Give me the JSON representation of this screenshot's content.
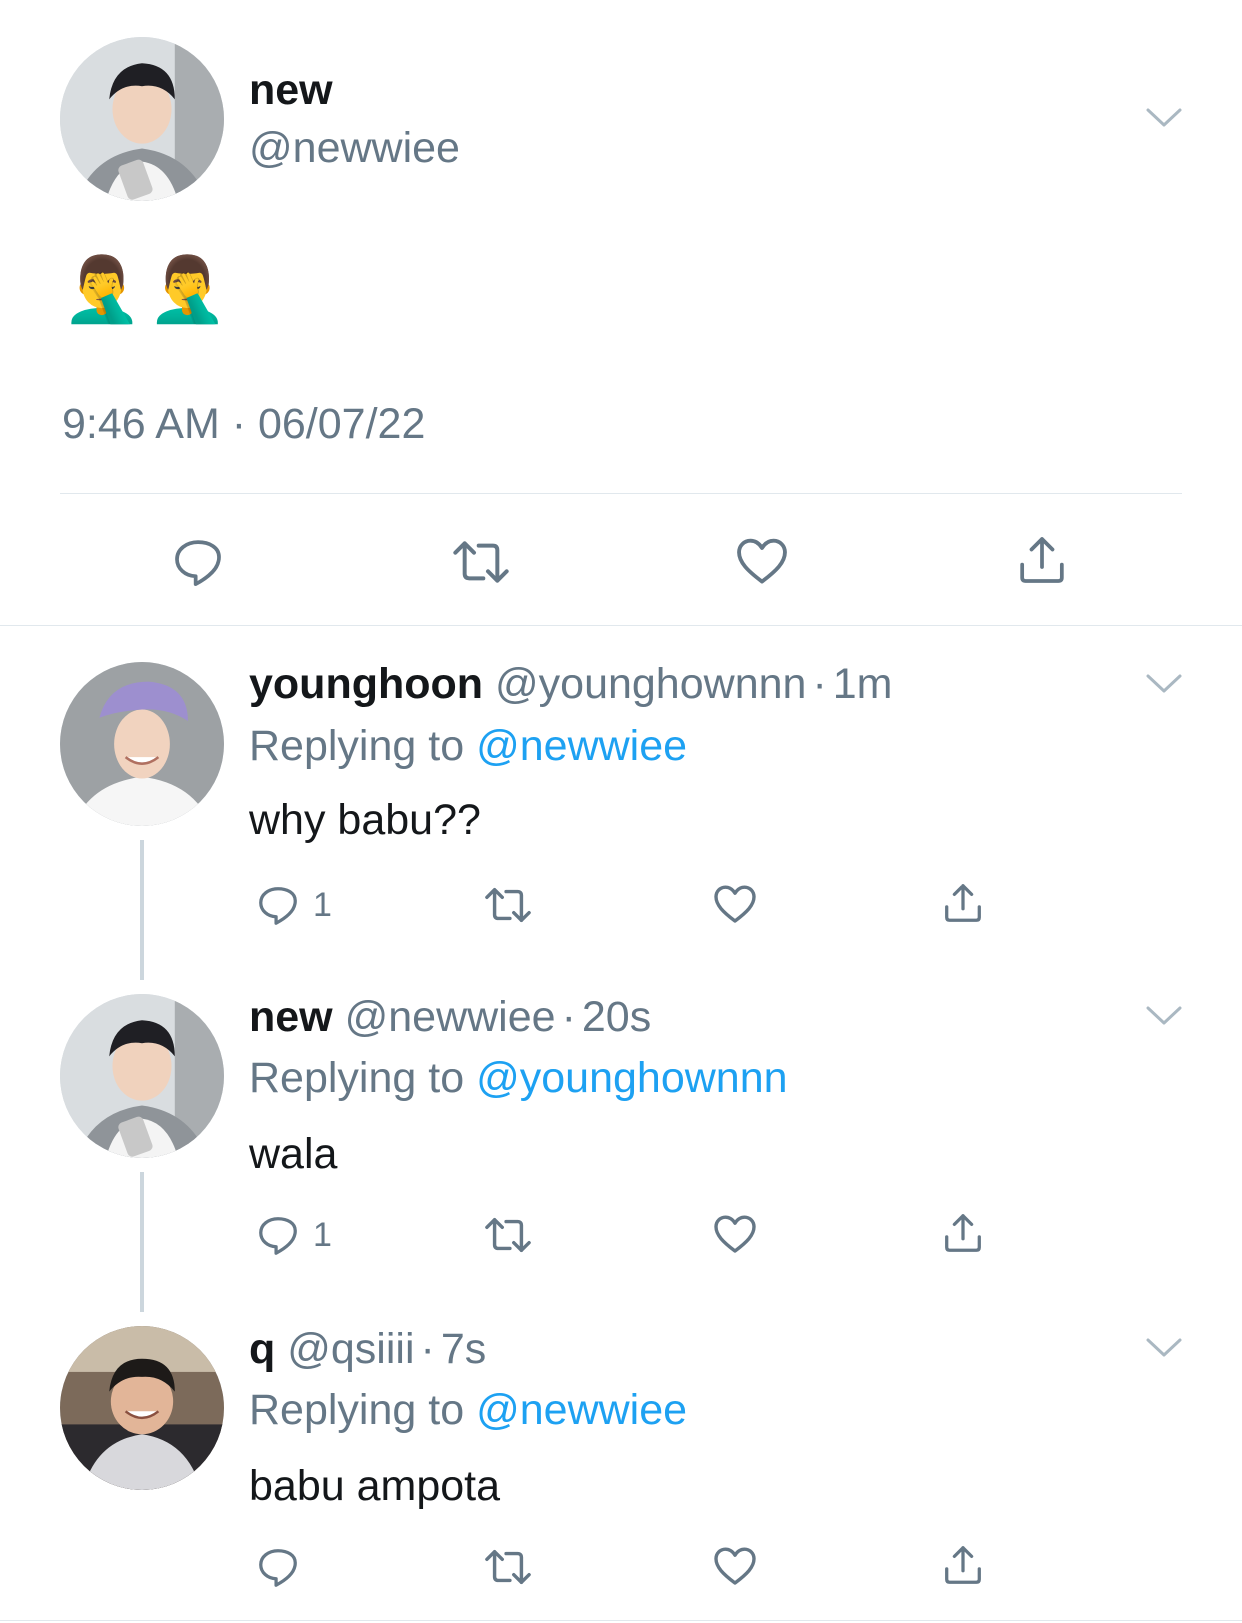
{
  "main_tweet": {
    "display_name": "new",
    "handle": "@newwiee",
    "content": "🤦‍♂️🤦‍♂️",
    "timestamp": "9:46 AM · 06/07/22"
  },
  "replies": [
    {
      "display_name": "younghoon",
      "handle": "@younghownnn",
      "age": "1m",
      "replying_label": "Replying to",
      "replying_to": "@newwiee",
      "text": "why babu??",
      "reply_count": "1"
    },
    {
      "display_name": "new",
      "handle": "@newwiee",
      "age": "20s",
      "replying_label": "Replying to",
      "replying_to": "@younghownnn",
      "text": "wala",
      "reply_count": "1"
    },
    {
      "display_name": "q",
      "handle": "@qsiiii",
      "age": "7s",
      "replying_label": "Replying to",
      "replying_to": "@newwiee",
      "text": "babu ampota",
      "reply_count": ""
    }
  ],
  "separator": "·",
  "colors": {
    "text": "#14171a",
    "secondary": "#657786",
    "link": "#1da1f2",
    "divider": "#e1e8ed",
    "thread_line": "#ccd6dd"
  },
  "icons": [
    "chevron-down-icon",
    "reply-icon",
    "retweet-icon",
    "like-icon",
    "share-icon"
  ]
}
